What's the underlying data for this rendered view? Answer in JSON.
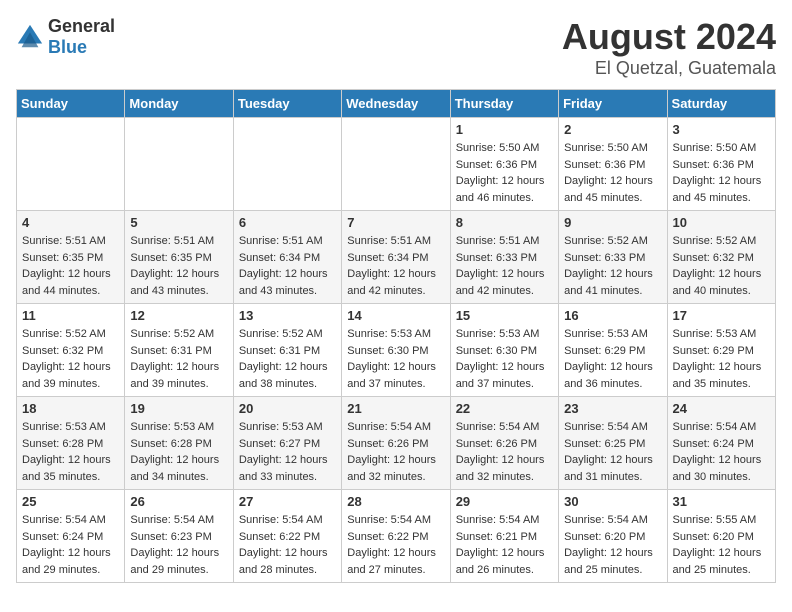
{
  "header": {
    "logo_general": "General",
    "logo_blue": "Blue",
    "title": "August 2024",
    "subtitle": "El Quetzal, Guatemala"
  },
  "weekdays": [
    "Sunday",
    "Monday",
    "Tuesday",
    "Wednesday",
    "Thursday",
    "Friday",
    "Saturday"
  ],
  "weeks": [
    [
      {
        "day": "",
        "sunrise": "",
        "sunset": "",
        "daylight": ""
      },
      {
        "day": "",
        "sunrise": "",
        "sunset": "",
        "daylight": ""
      },
      {
        "day": "",
        "sunrise": "",
        "sunset": "",
        "daylight": ""
      },
      {
        "day": "",
        "sunrise": "",
        "sunset": "",
        "daylight": ""
      },
      {
        "day": "1",
        "sunrise": "Sunrise: 5:50 AM",
        "sunset": "Sunset: 6:36 PM",
        "daylight": "Daylight: 12 hours and 46 minutes."
      },
      {
        "day": "2",
        "sunrise": "Sunrise: 5:50 AM",
        "sunset": "Sunset: 6:36 PM",
        "daylight": "Daylight: 12 hours and 45 minutes."
      },
      {
        "day": "3",
        "sunrise": "Sunrise: 5:50 AM",
        "sunset": "Sunset: 6:36 PM",
        "daylight": "Daylight: 12 hours and 45 minutes."
      }
    ],
    [
      {
        "day": "4",
        "sunrise": "Sunrise: 5:51 AM",
        "sunset": "Sunset: 6:35 PM",
        "daylight": "Daylight: 12 hours and 44 minutes."
      },
      {
        "day": "5",
        "sunrise": "Sunrise: 5:51 AM",
        "sunset": "Sunset: 6:35 PM",
        "daylight": "Daylight: 12 hours and 43 minutes."
      },
      {
        "day": "6",
        "sunrise": "Sunrise: 5:51 AM",
        "sunset": "Sunset: 6:34 PM",
        "daylight": "Daylight: 12 hours and 43 minutes."
      },
      {
        "day": "7",
        "sunrise": "Sunrise: 5:51 AM",
        "sunset": "Sunset: 6:34 PM",
        "daylight": "Daylight: 12 hours and 42 minutes."
      },
      {
        "day": "8",
        "sunrise": "Sunrise: 5:51 AM",
        "sunset": "Sunset: 6:33 PM",
        "daylight": "Daylight: 12 hours and 42 minutes."
      },
      {
        "day": "9",
        "sunrise": "Sunrise: 5:52 AM",
        "sunset": "Sunset: 6:33 PM",
        "daylight": "Daylight: 12 hours and 41 minutes."
      },
      {
        "day": "10",
        "sunrise": "Sunrise: 5:52 AM",
        "sunset": "Sunset: 6:32 PM",
        "daylight": "Daylight: 12 hours and 40 minutes."
      }
    ],
    [
      {
        "day": "11",
        "sunrise": "Sunrise: 5:52 AM",
        "sunset": "Sunset: 6:32 PM",
        "daylight": "Daylight: 12 hours and 39 minutes."
      },
      {
        "day": "12",
        "sunrise": "Sunrise: 5:52 AM",
        "sunset": "Sunset: 6:31 PM",
        "daylight": "Daylight: 12 hours and 39 minutes."
      },
      {
        "day": "13",
        "sunrise": "Sunrise: 5:52 AM",
        "sunset": "Sunset: 6:31 PM",
        "daylight": "Daylight: 12 hours and 38 minutes."
      },
      {
        "day": "14",
        "sunrise": "Sunrise: 5:53 AM",
        "sunset": "Sunset: 6:30 PM",
        "daylight": "Daylight: 12 hours and 37 minutes."
      },
      {
        "day": "15",
        "sunrise": "Sunrise: 5:53 AM",
        "sunset": "Sunset: 6:30 PM",
        "daylight": "Daylight: 12 hours and 37 minutes."
      },
      {
        "day": "16",
        "sunrise": "Sunrise: 5:53 AM",
        "sunset": "Sunset: 6:29 PM",
        "daylight": "Daylight: 12 hours and 36 minutes."
      },
      {
        "day": "17",
        "sunrise": "Sunrise: 5:53 AM",
        "sunset": "Sunset: 6:29 PM",
        "daylight": "Daylight: 12 hours and 35 minutes."
      }
    ],
    [
      {
        "day": "18",
        "sunrise": "Sunrise: 5:53 AM",
        "sunset": "Sunset: 6:28 PM",
        "daylight": "Daylight: 12 hours and 35 minutes."
      },
      {
        "day": "19",
        "sunrise": "Sunrise: 5:53 AM",
        "sunset": "Sunset: 6:28 PM",
        "daylight": "Daylight: 12 hours and 34 minutes."
      },
      {
        "day": "20",
        "sunrise": "Sunrise: 5:53 AM",
        "sunset": "Sunset: 6:27 PM",
        "daylight": "Daylight: 12 hours and 33 minutes."
      },
      {
        "day": "21",
        "sunrise": "Sunrise: 5:54 AM",
        "sunset": "Sunset: 6:26 PM",
        "daylight": "Daylight: 12 hours and 32 minutes."
      },
      {
        "day": "22",
        "sunrise": "Sunrise: 5:54 AM",
        "sunset": "Sunset: 6:26 PM",
        "daylight": "Daylight: 12 hours and 32 minutes."
      },
      {
        "day": "23",
        "sunrise": "Sunrise: 5:54 AM",
        "sunset": "Sunset: 6:25 PM",
        "daylight": "Daylight: 12 hours and 31 minutes."
      },
      {
        "day": "24",
        "sunrise": "Sunrise: 5:54 AM",
        "sunset": "Sunset: 6:24 PM",
        "daylight": "Daylight: 12 hours and 30 minutes."
      }
    ],
    [
      {
        "day": "25",
        "sunrise": "Sunrise: 5:54 AM",
        "sunset": "Sunset: 6:24 PM",
        "daylight": "Daylight: 12 hours and 29 minutes."
      },
      {
        "day": "26",
        "sunrise": "Sunrise: 5:54 AM",
        "sunset": "Sunset: 6:23 PM",
        "daylight": "Daylight: 12 hours and 29 minutes."
      },
      {
        "day": "27",
        "sunrise": "Sunrise: 5:54 AM",
        "sunset": "Sunset: 6:22 PM",
        "daylight": "Daylight: 12 hours and 28 minutes."
      },
      {
        "day": "28",
        "sunrise": "Sunrise: 5:54 AM",
        "sunset": "Sunset: 6:22 PM",
        "daylight": "Daylight: 12 hours and 27 minutes."
      },
      {
        "day": "29",
        "sunrise": "Sunrise: 5:54 AM",
        "sunset": "Sunset: 6:21 PM",
        "daylight": "Daylight: 12 hours and 26 minutes."
      },
      {
        "day": "30",
        "sunrise": "Sunrise: 5:54 AM",
        "sunset": "Sunset: 6:20 PM",
        "daylight": "Daylight: 12 hours and 25 minutes."
      },
      {
        "day": "31",
        "sunrise": "Sunrise: 5:55 AM",
        "sunset": "Sunset: 6:20 PM",
        "daylight": "Daylight: 12 hours and 25 minutes."
      }
    ]
  ]
}
